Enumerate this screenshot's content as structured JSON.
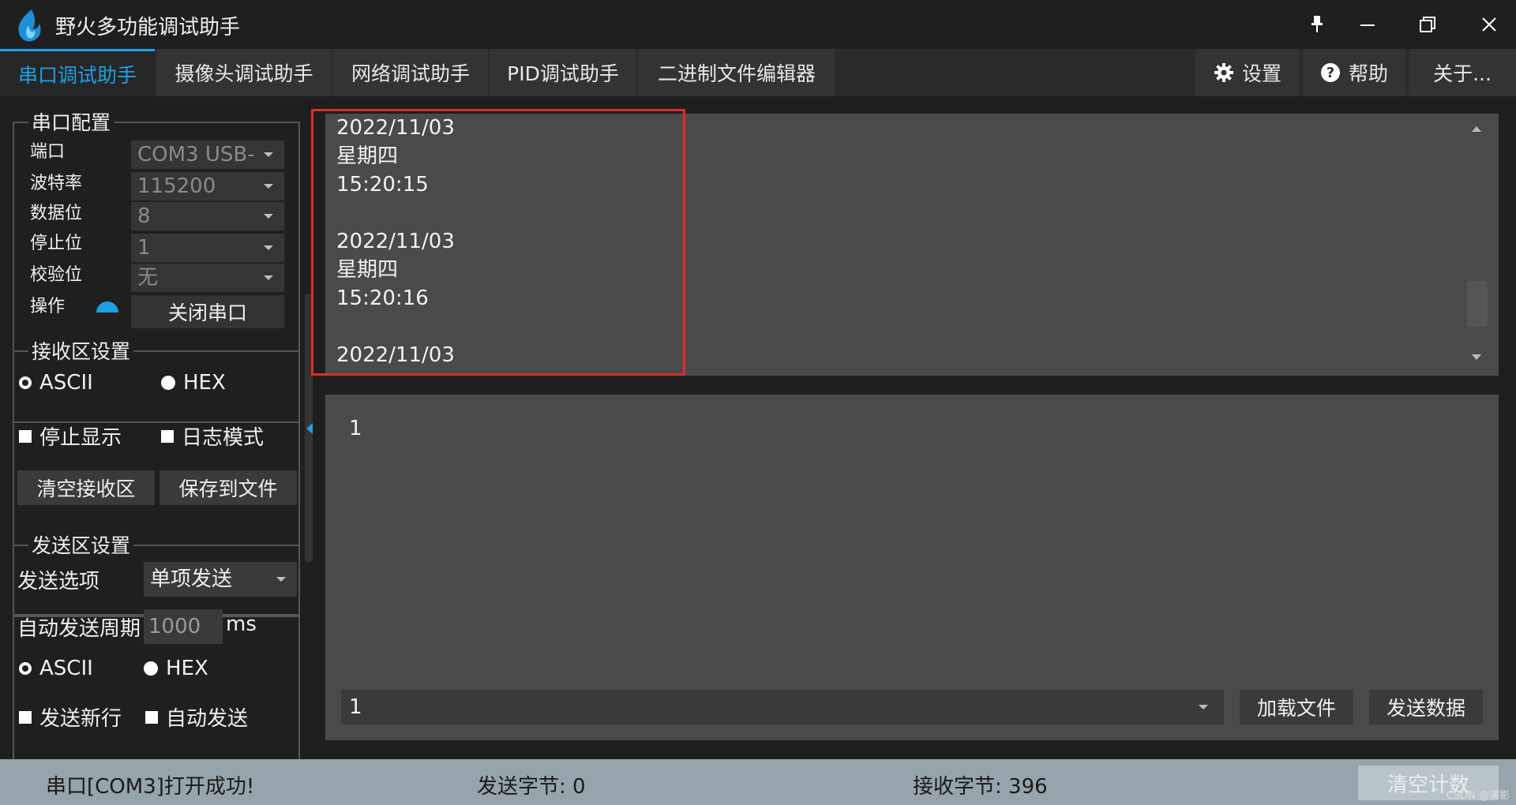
{
  "window": {
    "title": "野火多功能调试助手",
    "accent": "#1ea0e6"
  },
  "tabs": [
    {
      "label": "串口调试助手",
      "active": true
    },
    {
      "label": "摄像头调试助手",
      "active": false
    },
    {
      "label": "网络调试助手",
      "active": false
    },
    {
      "label": "PID调试助手",
      "active": false
    },
    {
      "label": "二进制文件编辑器",
      "active": false
    }
  ],
  "right_tabs": {
    "settings": {
      "label": "设置",
      "icon": "gear-icon"
    },
    "help": {
      "label": "帮助",
      "icon": "question-icon"
    },
    "about": {
      "label": "关于..."
    }
  },
  "serial_config": {
    "title": "串口配置",
    "port_label": "端口",
    "port_value": "COM3 USB-",
    "baud_label": "波特率",
    "baud_value": "115200",
    "databits_label": "数据位",
    "databits_value": "8",
    "stopbits_label": "停止位",
    "stopbits_value": "1",
    "parity_label": "校验位",
    "parity_value": "无",
    "operation_label": "操作",
    "operation_state": "on",
    "close_button": "关闭串口"
  },
  "receive_settings": {
    "title": "接收区设置",
    "ascii_label": "ASCII",
    "hex_label": "HEX",
    "stop_display_label": "停止显示",
    "log_mode_label": "日志模式",
    "clear_button": "清空接收区",
    "save_button": "保存到文件"
  },
  "send_settings": {
    "title": "发送区设置",
    "option_label": "发送选项",
    "option_value": "单项发送",
    "period_label": "自动发送周期",
    "period_value": "1000",
    "period_unit": "ms",
    "ascii_label": "ASCII",
    "hex_label": "HEX",
    "newline_label": "发送新行",
    "auto_send_label": "自动发送"
  },
  "receive_area": {
    "text": "2022/11/03\n星期四\n15:20:15\n\n2022/11/03\n星期四\n15:20:16\n\n2022/11/03"
  },
  "send_area": {
    "text": "1",
    "history_value": "1",
    "load_file_button": "加载文件",
    "send_button": "发送数据"
  },
  "status": {
    "message": "串口[COM3]打开成功!",
    "sent_bytes": "发送字节: 0",
    "received_bytes": "接收字节: 396",
    "clear_count_button": "清空计数",
    "watermark": "CSDN @演影"
  }
}
